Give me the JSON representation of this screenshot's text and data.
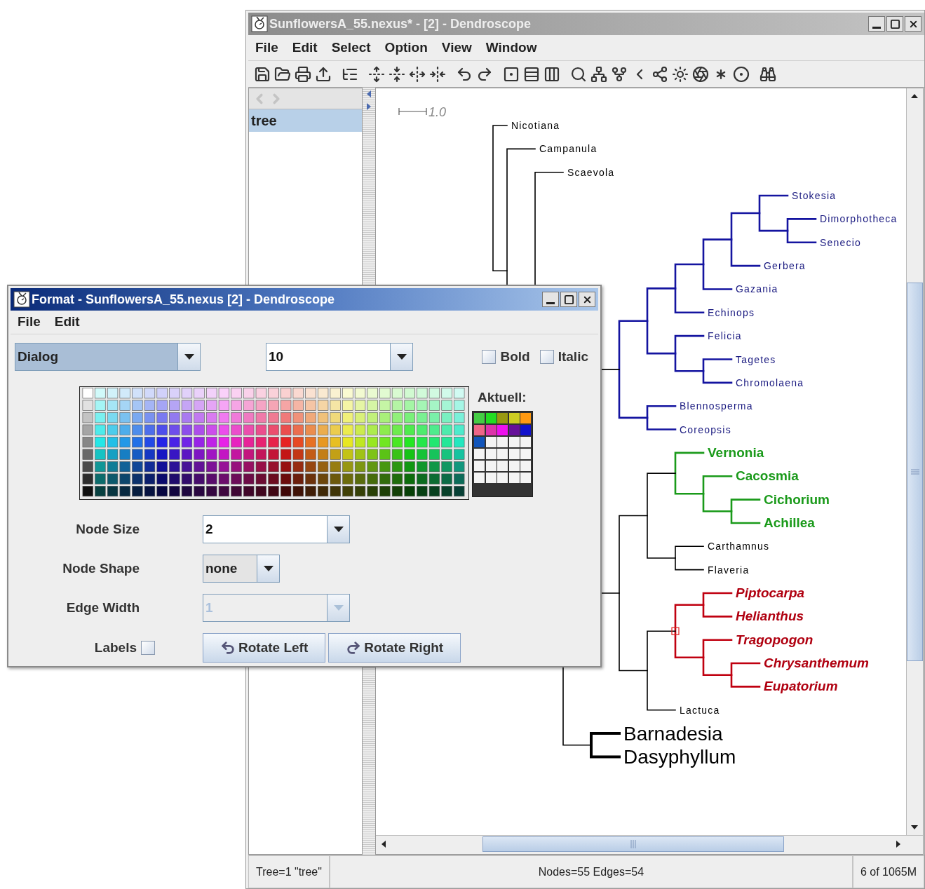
{
  "main_window": {
    "title": "SunflowersA_55.nexus* - [2] - Dendroscope",
    "active": false,
    "menu": [
      "File",
      "Edit",
      "Select",
      "Option",
      "View",
      "Window"
    ],
    "tree_list": {
      "items": [
        {
          "label": "tree",
          "selected": true
        }
      ]
    },
    "scale_bar": {
      "label": "1.0"
    },
    "tree": {
      "color": "#000000",
      "selected": false,
      "children": [
        {
          "label": "Nicotiana",
          "kind": "plain",
          "color": "#000000"
        },
        {
          "color": "#000000",
          "selected": false,
          "children": [
            {
              "label": "Campanula",
              "kind": "plain",
              "color": "#000000"
            },
            {
              "color": "#000000",
              "children": [
                {
                  "label": "Scaevola",
                  "kind": "plain",
                  "color": "#000000"
                },
                {
                  "color": "#000000",
                  "children": [
                    {
                      "color": "#000000",
                      "children": [
                        {
                          "color": "#1414a0",
                          "selected": false,
                          "children": [
                            {
                              "color": "#1414a0",
                              "selected": false,
                              "children": [
                                {
                                  "color": "#1414a0",
                                  "selected": false,
                                  "children": [
                                    {
                                      "color": "#1414a0",
                                      "selected": false,
                                      "children": [
                                        {
                                          "color": "#1414a0",
                                          "selected": false,
                                          "children": [
                                            {
                                              "color": "#1414a0",
                                              "selected": false,
                                              "children": [
                                                {
                                                  "label": "Stokesia",
                                                  "kind": "plain",
                                                  "color": "#1a1a80"
                                                },
                                                {
                                                  "color": "#1414a0",
                                                  "selected": false,
                                                  "children": [
                                                    {
                                                      "label": "Dimorphotheca",
                                                      "kind": "plain",
                                                      "color": "#1a1a80"
                                                    },
                                                    {
                                                      "label": "Senecio",
                                                      "kind": "plain",
                                                      "color": "#1a1a80"
                                                    }
                                                  ]
                                                }
                                              ]
                                            },
                                            {
                                              "label": "Gerbera",
                                              "kind": "plain",
                                              "color": "#1a1a80"
                                            }
                                          ]
                                        },
                                        {
                                          "label": "Gazania",
                                          "kind": "plain",
                                          "color": "#1a1a80"
                                        }
                                      ]
                                    },
                                    {
                                      "label": "Echinops",
                                      "kind": "plain",
                                      "color": "#1a1a80"
                                    }
                                  ]
                                },
                                {
                                  "color": "#1414a0",
                                  "selected": false,
                                  "children": [
                                    {
                                      "label": "Felicia",
                                      "kind": "plain",
                                      "color": "#1a1a80"
                                    },
                                    {
                                      "color": "#1414a0",
                                      "selected": false,
                                      "children": [
                                        {
                                          "label": "Tagetes",
                                          "kind": "plain",
                                          "color": "#1a1a80"
                                        },
                                        {
                                          "label": "Chromolaena",
                                          "kind": "plain",
                                          "color": "#1a1a80"
                                        }
                                      ]
                                    }
                                  ]
                                }
                              ]
                            },
                            {
                              "color": "#1414a0",
                              "selected": false,
                              "children": [
                                {
                                  "label": "Blennosperma",
                                  "kind": "plain",
                                  "color": "#1a1a80"
                                },
                                {
                                  "label": "Coreopsis",
                                  "kind": "plain",
                                  "color": "#1a1a80"
                                }
                              ]
                            }
                          ]
                        },
                        {
                          "color": "#000000",
                          "selected": false,
                          "children": [
                            {
                              "color": "#000000",
                              "selected": false,
                              "children": [
                                {
                                  "color": "#1a9a1a",
                                  "selected": false,
                                  "children": [
                                    {
                                      "label": "Vernonia",
                                      "kind": "strong",
                                      "color": "#1a9a1a"
                                    },
                                    {
                                      "color": "#1a9a1a",
                                      "selected": false,
                                      "children": [
                                        {
                                          "label": "Cacosmia",
                                          "kind": "strong",
                                          "color": "#1a9a1a"
                                        },
                                        {
                                          "color": "#1a9a1a",
                                          "selected": false,
                                          "children": [
                                            {
                                              "label": "Cichorium",
                                              "kind": "strong",
                                              "color": "#1a9a1a"
                                            },
                                            {
                                              "label": "Achillea",
                                              "kind": "strong",
                                              "color": "#1a9a1a"
                                            }
                                          ]
                                        }
                                      ]
                                    }
                                  ]
                                },
                                {
                                  "color": "#000000",
                                  "selected": false,
                                  "children": [
                                    {
                                      "label": "Carthamnus",
                                      "kind": "plain",
                                      "color": "#000000"
                                    },
                                    {
                                      "label": "Flaveria",
                                      "kind": "plain",
                                      "color": "#000000"
                                    }
                                  ]
                                }
                              ]
                            },
                            {
                              "color": "#000000",
                              "selected": false,
                              "children": [
                                {
                                  "color": "#c00010",
                                  "selected": true,
                                  "children": [
                                    {
                                      "color": "#c00010",
                                      "selected": false,
                                      "children": [
                                        {
                                          "label": "Piptocarpa",
                                          "kind": "emphatic",
                                          "color": "#b00010"
                                        },
                                        {
                                          "label": "Helianthus",
                                          "kind": "emphatic",
                                          "color": "#b00010"
                                        }
                                      ]
                                    },
                                    {
                                      "color": "#c00010",
                                      "selected": false,
                                      "children": [
                                        {
                                          "label": "Tragopogon",
                                          "kind": "emphatic",
                                          "color": "#b00010"
                                        },
                                        {
                                          "color": "#c00010",
                                          "selected": false,
                                          "children": [
                                            {
                                              "label": "Chrysanthemum",
                                              "kind": "emphatic",
                                              "color": "#b00010"
                                            },
                                            {
                                              "label": "Eupatorium",
                                              "kind": "emphatic",
                                              "color": "#b00010"
                                            }
                                          ]
                                        }
                                      ]
                                    }
                                  ]
                                },
                                {
                                  "label": "Lactuca",
                                  "kind": "plain",
                                  "color": "#000000"
                                }
                              ]
                            }
                          ]
                        }
                      ]
                    },
                    {
                      "color": "#000000",
                      "selected": false,
                      "children": [
                        {
                          "label": "Barnadesia",
                          "kind": "large",
                          "color": "#000000"
                        },
                        {
                          "label": "Dasyphyllum",
                          "kind": "large",
                          "color": "#000000"
                        }
                      ]
                    }
                  ]
                }
              ]
            }
          ]
        }
      ]
    },
    "status_bar": [
      "Tree=1 \"tree\"",
      "Nodes=55 Edges=54",
      "6 of 1065M"
    ]
  },
  "format_dialog": {
    "title": "Format - SunflowersA_55.nexus [2] - Dendroscope",
    "active": true,
    "menu": [
      "File",
      "Edit"
    ],
    "font": {
      "value": "Dialog"
    },
    "size": {
      "value": "10"
    },
    "bold": {
      "label": "Bold",
      "checked": false
    },
    "italic": {
      "label": "Italic",
      "checked": false
    },
    "recent_label": "Aktuell:",
    "recent_colors": [
      {
        "color": "#44cc44"
      },
      {
        "color": "#22dd22"
      },
      {
        "color": "#999911"
      },
      {
        "color": "#cccc22"
      },
      {
        "color": "#ff9911"
      },
      {
        "color": "#ee6688"
      },
      {
        "color": "#dd33aa"
      },
      {
        "color": "#ee11ee"
      },
      {
        "color": "#661199"
      },
      {
        "color": "#1111cc"
      },
      {
        "color": "#1155bb"
      }
    ],
    "node_size": {
      "label": "Node Size",
      "value": "2",
      "disabled": false
    },
    "node_shape": {
      "label": "Node Shape",
      "value": "none",
      "disabled": false
    },
    "edge_width": {
      "label": "Edge Width",
      "value": "1",
      "disabled": true
    },
    "labels": {
      "label": "Labels",
      "checked": false
    },
    "buttons": [
      "Rotate Left",
      "Rotate Right"
    ]
  }
}
